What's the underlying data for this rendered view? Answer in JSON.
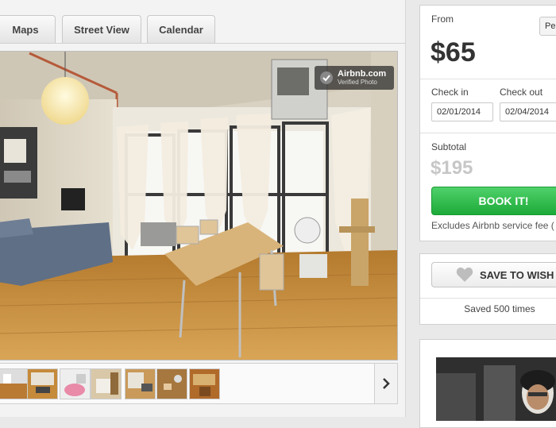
{
  "tabs": [
    {
      "label": "Maps"
    },
    {
      "label": "Street View"
    },
    {
      "label": "Calendar"
    }
  ],
  "photo": {
    "badge_brand": "Airbnb.com",
    "badge_sub": "Verified Photo"
  },
  "thumbnails": {
    "count": 7,
    "next_icon": "chevron-right-icon"
  },
  "booking": {
    "from_label": "From",
    "price": "$65",
    "per_select": "Pe",
    "checkin_label": "Check in",
    "checkin_value": "02/01/2014",
    "checkout_label": "Check out",
    "checkout_value": "02/04/2014",
    "subtotal_label": "Subtotal",
    "subtotal_value": "$195",
    "book_label": "BOOK IT!",
    "fee_note": "Excludes Airbnb service fee (",
    "book_color": "#29b648"
  },
  "wishlist": {
    "save_label": "SAVE TO WISH",
    "saved_count": "Saved 500 times",
    "icon": "heart-icon"
  }
}
